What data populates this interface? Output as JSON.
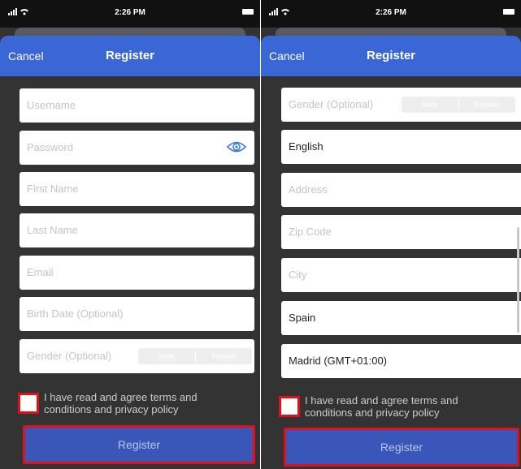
{
  "status": {
    "time": "2:26 PM"
  },
  "colors": {
    "nav": "#3a66d6",
    "background": "#333333",
    "button": "#3a56b8",
    "highlight": "#e0101a"
  },
  "left": {
    "nav": {
      "cancel": "Cancel",
      "title": "Register"
    },
    "fields": {
      "username_placeholder": "Username",
      "password_placeholder": "Password",
      "first_name_placeholder": "First Name",
      "last_name_placeholder": "Last Name",
      "email_placeholder": "Email",
      "birth_date_placeholder": "Birth Date (Optional)",
      "gender_placeholder": "Gender (Optional)"
    },
    "gender_options": [
      "Male",
      "Female"
    ],
    "terms_text": "I have read and agree terms and conditions and privacy policy",
    "register_button": "Register",
    "password_icon": "eye-icon"
  },
  "right": {
    "nav": {
      "cancel": "Cancel",
      "title": "Register"
    },
    "fields": {
      "gender_placeholder": "Gender (Optional)",
      "language_value": "English",
      "address_placeholder": "Address",
      "zip_placeholder": "Zip Code",
      "city_placeholder": "City",
      "country_value": "Spain",
      "timezone_value": "Madrid (GMT+01:00)"
    },
    "gender_options": [
      "Male",
      "Female"
    ],
    "terms_text": "I have read and agree terms and conditions and privacy policy",
    "register_button": "Register"
  }
}
